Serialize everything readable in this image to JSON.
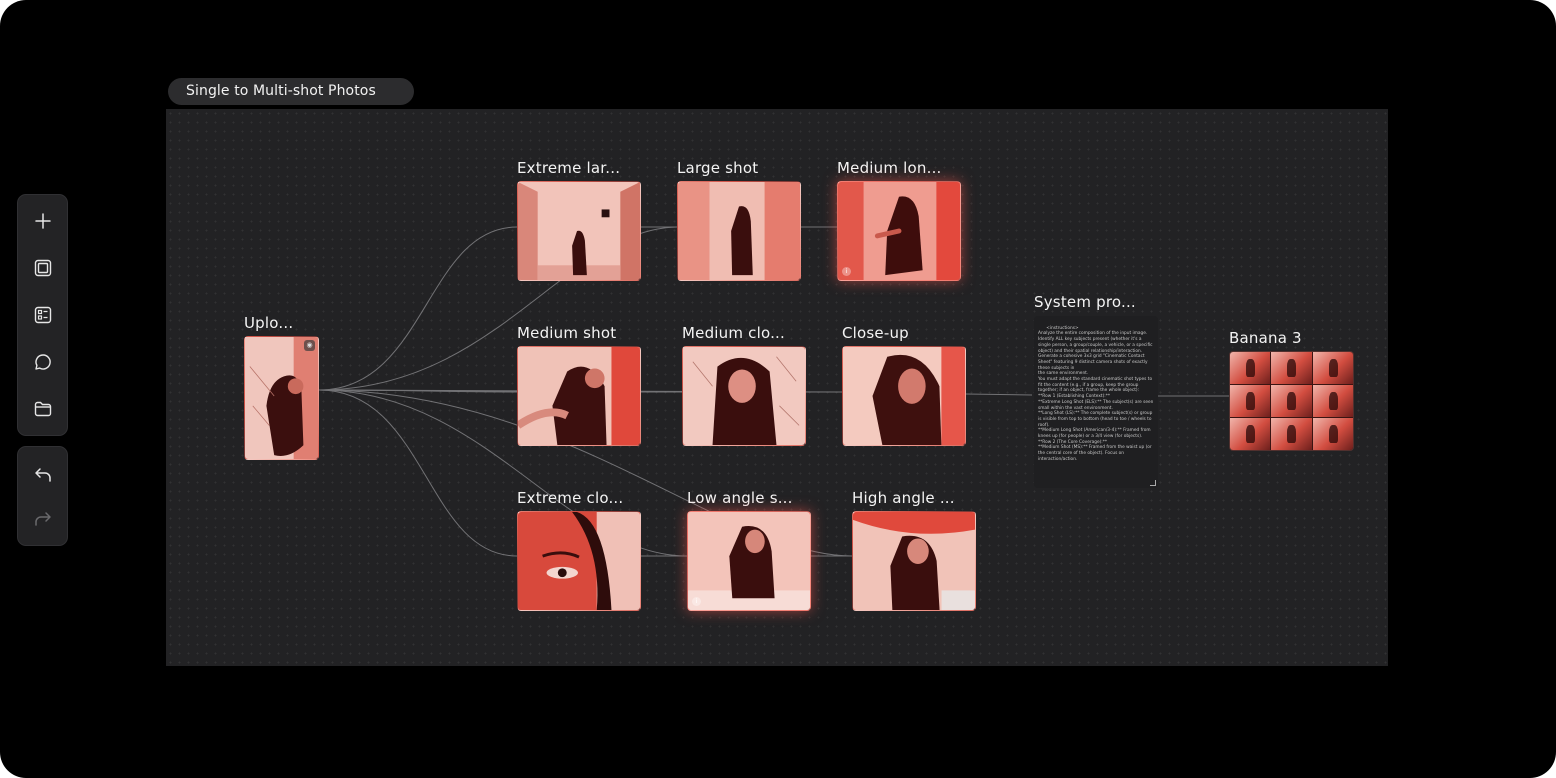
{
  "workflow": {
    "title": "Single to Multi-shot Photos"
  },
  "toolbar": {
    "items": [
      {
        "name": "add-node-button",
        "icon": "plus-icon"
      },
      {
        "name": "frame-button",
        "icon": "square-frame-icon"
      },
      {
        "name": "templates-button",
        "icon": "list-layout-icon"
      },
      {
        "name": "comment-button",
        "icon": "chat-bubble-icon"
      },
      {
        "name": "folder-button",
        "icon": "folder-icon"
      }
    ],
    "history": [
      {
        "name": "undo-button",
        "icon": "undo-icon"
      },
      {
        "name": "redo-button",
        "icon": "redo-icon"
      }
    ]
  },
  "nodes": {
    "upload": {
      "label": "Uplo..."
    },
    "extreme_large": {
      "label": "Extreme lar..."
    },
    "large_shot": {
      "label": "Large shot"
    },
    "medium_long": {
      "label": "Medium lon..."
    },
    "medium_shot": {
      "label": "Medium shot"
    },
    "medium_close": {
      "label": "Medium clo..."
    },
    "close_up": {
      "label": "Close-up"
    },
    "extreme_close": {
      "label": "Extreme clo..."
    },
    "low_angle": {
      "label": "Low angle s..."
    },
    "high_angle": {
      "label": "High angle ..."
    },
    "system_prompt": {
      "label": "System pro..."
    },
    "output": {
      "label": "Banana 3"
    }
  },
  "system_prompt_text": "<instructions>\nAnalyze the entire composition of the input image. Identify ALL key subjects present (whether it's a single person, a group/couple, a vehicle, or a specific object) and their spatial relationship/interaction.\nGenerate a cohesive 3x3 grid \"Cinematic Contact Sheet\" featuring 9 distinct camera shots of exactly these subjects in\nthe same environment.\nYou must adapt the standard cinematic shot types to fit the content (e.g., if a group, keep the group together; if an object, frame the whole object):\n**Row 1 (Establishing Context):**\n**Extreme Long Shot (ELS):** The subject(s) are seen small within the vast environment.\n**Long Shot (LS):** The complete subject(s) or group is visible from top to bottom (head to toe / wheels to roof).\n**Medium Long Shot (American/3-4):** Framed from knees up (for people) or a 3/4 view (for objects).\n**Row 2 (The Core Coverage):**\n**Medium Shot (MS):** Framed from the waist up (or the central core of the object). Focus on interaction/action.",
  "colors": {
    "frame": "#000000",
    "canvas": "#222224",
    "accent": "#e8564a",
    "edge": "#8d8d90"
  }
}
